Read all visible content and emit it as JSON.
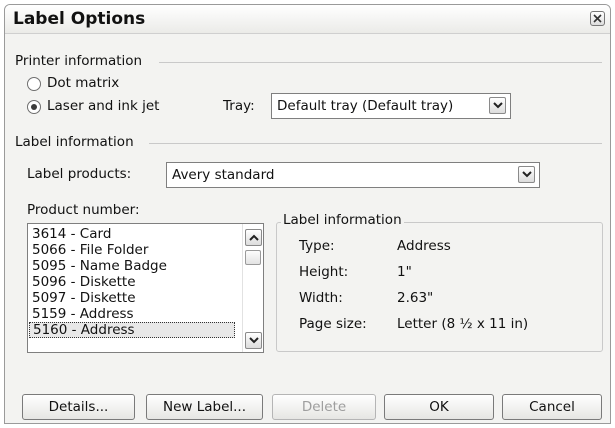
{
  "dialog": {
    "title": "Label Options"
  },
  "printer": {
    "section_label": "Printer information",
    "dot_matrix_label": "Dot matrix",
    "laser_label": "Laser and ink jet",
    "selected": "laser",
    "tray_label": "Tray:",
    "tray_value": "Default tray (Default tray)"
  },
  "label_info_section": {
    "section_label": "Label information",
    "products_label": "Label products:",
    "products_value": "Avery standard"
  },
  "product_number": {
    "label": "Product number:",
    "items": [
      "3614 - Card",
      "5066 - File Folder",
      "5095 - Name Badge",
      "5096 - Diskette",
      "5097 - Diskette",
      "5159 - Address",
      "5160 - Address"
    ],
    "selected_index": 6
  },
  "details_group": {
    "title": "Label information",
    "type_label": "Type:",
    "type_value": "Address",
    "height_label": "Height:",
    "height_value": "1\"",
    "width_label": "Width:",
    "width_value": "2.63\"",
    "pagesize_label": "Page size:",
    "pagesize_value": "Letter (8 ½ x 11 in)"
  },
  "buttons": {
    "details": "Details...",
    "new_label": "New Label...",
    "delete": "Delete",
    "ok": "OK",
    "cancel": "Cancel"
  },
  "icons": {
    "close": "close-icon",
    "dropdown": "chevron-down-icon",
    "scroll_up": "chevron-up-icon"
  },
  "colors": {
    "dialog_bg": "#f3f3f1",
    "selection_bg": "#e8e8e8",
    "border": "#7f7f7f",
    "disabled_text": "#9e9e9e"
  }
}
